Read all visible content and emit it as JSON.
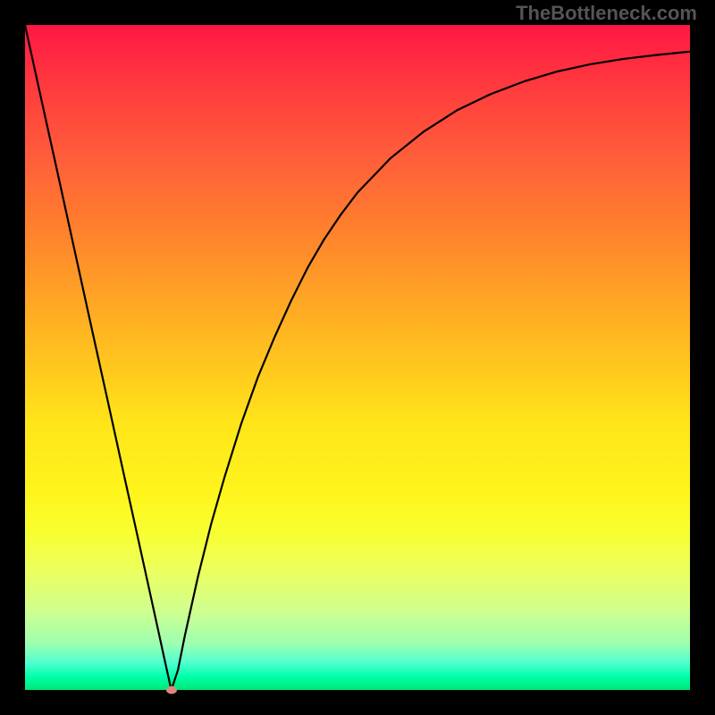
{
  "watermark": "TheBottleneck.com",
  "chart_data": {
    "type": "line",
    "title": "",
    "xlabel": "",
    "ylabel": "",
    "xlim": [
      0,
      100
    ],
    "ylim": [
      0,
      100
    ],
    "series": [
      {
        "name": "curve",
        "x": [
          0,
          2.5,
          5,
          7.5,
          10,
          12.5,
          15,
          17.5,
          20,
          21,
          22,
          23,
          24,
          26,
          28,
          30,
          32.5,
          35,
          37.5,
          40,
          42.5,
          45,
          47.5,
          50,
          55,
          60,
          65,
          70,
          75,
          80,
          85,
          90,
          95,
          100
        ],
        "y": [
          100,
          88.6,
          77.3,
          65.9,
          54.5,
          43.2,
          31.8,
          20.5,
          9.1,
          4.5,
          0,
          3,
          8,
          17,
          25,
          32,
          40,
          47,
          53,
          58.5,
          63.5,
          67.8,
          71.5,
          74.8,
          80,
          84,
          87.2,
          89.6,
          91.5,
          93,
          94.1,
          94.9,
          95.5,
          96
        ]
      }
    ],
    "marker": {
      "x": 22,
      "y": 0
    },
    "background_gradient": {
      "top": "#ff1744",
      "middle": "#ffe51a",
      "bottom": "#00e676"
    },
    "grid": false
  }
}
